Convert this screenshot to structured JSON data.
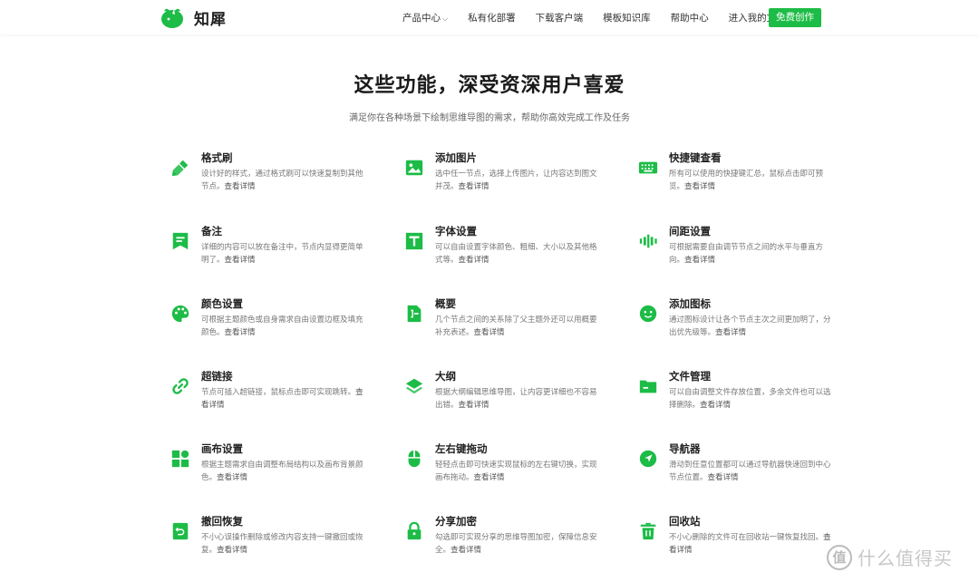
{
  "brand": {
    "name": "知犀",
    "color": "#1cbc46"
  },
  "nav": {
    "items": [
      "产品中心",
      "私有化部署",
      "下载客户端",
      "模板知识库",
      "帮助中心",
      "进入我的文件"
    ],
    "cta": "免费创作"
  },
  "hero": {
    "title": "这些功能，深受资深用户喜爱",
    "subtitle": "满足你在各种场景下绘制思维导图的需求，帮助你高效完成工作及任务"
  },
  "features": [
    {
      "title": "格式刷",
      "desc": "设计好的样式，通过格式刷可以快速复制到其他节点。",
      "more": "查看详情",
      "icon": "format-brush-icon"
    },
    {
      "title": "添加图片",
      "desc": "选中任一节点，选择上传图片，让内容达到图文并茂。",
      "more": "查看详情",
      "icon": "image-icon"
    },
    {
      "title": "快捷键查看",
      "desc": "所有可以使用的快捷键汇总，鼠标点击即可预览。",
      "more": "查看详情",
      "icon": "keyboard-icon"
    },
    {
      "title": "备注",
      "desc": "详细的内容可以放在备注中，节点内显得更简单明了。",
      "more": "查看详情",
      "icon": "note-icon"
    },
    {
      "title": "字体设置",
      "desc": "可以自由设置字体颜色、粗细、大小以及其他格式等。",
      "more": "查看详情",
      "icon": "font-icon"
    },
    {
      "title": "间距设置",
      "desc": "可根据需要自由调节节点之间的水平与垂直方向。",
      "more": "查看详情",
      "icon": "spacing-icon"
    },
    {
      "title": "颜色设置",
      "desc": "可根据主题颜色或自身需求自由设置边框及填充颜色。",
      "more": "查看详情",
      "icon": "palette-icon"
    },
    {
      "title": "概要",
      "desc": "几个节点之间的关系除了父主题外还可以用概要补充表述。",
      "more": "查看详情",
      "icon": "summary-icon"
    },
    {
      "title": "添加图标",
      "desc": "通过图标设计让各个节点主次之间更加明了，分出优先级等。",
      "more": "查看详情",
      "icon": "smiley-icon"
    },
    {
      "title": "超链接",
      "desc": "节点可插入超链接，鼠标点击即可实现跳转。",
      "more": "查看详情",
      "icon": "link-icon"
    },
    {
      "title": "大纲",
      "desc": "根据大纲编辑思维导图，让内容更详细也不容易出错。",
      "more": "查看详情",
      "icon": "layers-icon"
    },
    {
      "title": "文件管理",
      "desc": "可以自由调整文件存放位置，多余文件也可以选择删除。",
      "more": "查看详情",
      "icon": "folder-icon"
    },
    {
      "title": "画布设置",
      "desc": "根据主题需求自由调整布局结构以及画布背景颜色。",
      "more": "查看详情",
      "icon": "grid-icon"
    },
    {
      "title": "左右键拖动",
      "desc": "轻轻点击即可快速实现鼠标的左右键切换，实现画布拖动。",
      "more": "查看详情",
      "icon": "mouse-icon"
    },
    {
      "title": "导航器",
      "desc": "滑动到任意位置都可以通过导航器快速回到中心节点位置。",
      "more": "查看详情",
      "icon": "navigator-icon"
    },
    {
      "title": "撤回恢复",
      "desc": "不小心误操作删除或修改内容支持一键撤回或恢复。",
      "more": "查看详情",
      "icon": "undo-icon"
    },
    {
      "title": "分享加密",
      "desc": "勾选即可实现分享的思维导图加密，保障信息安全。",
      "more": "查看详情",
      "icon": "lock-icon"
    },
    {
      "title": "回收站",
      "desc": "不小心删除的文件可在回收站一键恢复找回。",
      "more": "查看详情",
      "icon": "trash-icon"
    }
  ],
  "watermark": {
    "symbol": "值",
    "text": "什么值得买"
  }
}
